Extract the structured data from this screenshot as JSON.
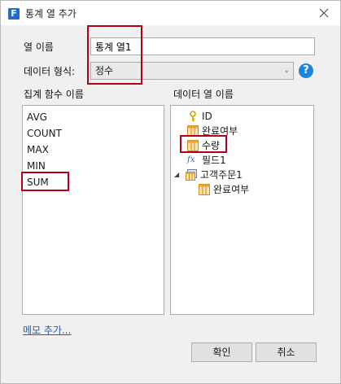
{
  "window": {
    "title": "통계 열 추가",
    "app_icon_letter": "F",
    "close_icon": "close-icon"
  },
  "form": {
    "column_name_label": "열 이름",
    "column_name_value": "통계 열1",
    "data_type_label": "데이터 형식:",
    "data_type_value": "정수",
    "help_icon_glyph": "?"
  },
  "functions": {
    "header": "집계 함수 이름",
    "items": [
      "AVG",
      "COUNT",
      "MAX",
      "MIN",
      "SUM"
    ]
  },
  "columns": {
    "header": "데이터 열 이름",
    "tree": [
      {
        "label": "ID",
        "icon": "key-icon"
      },
      {
        "label": "완료여부",
        "icon": "table-column-icon"
      },
      {
        "label": "수량",
        "icon": "table-column-icon"
      },
      {
        "label": "필드1",
        "icon": "formula-icon"
      },
      {
        "label": "고객주문1",
        "icon": "table-group-icon",
        "expanded": true
      },
      {
        "label": "완료여부",
        "icon": "table-column-icon"
      }
    ],
    "formula_glyph": "fx",
    "expander_glyph": "◢"
  },
  "footer": {
    "memo_link": "메모 추가...",
    "ok_label": "확인",
    "cancel_label": "취소"
  },
  "colors": {
    "highlight_border": "#b0001c",
    "accent": "#1b86d6"
  }
}
